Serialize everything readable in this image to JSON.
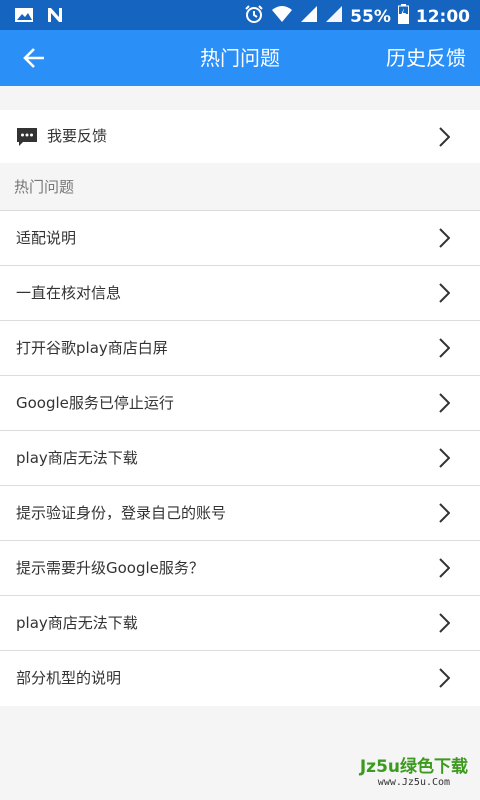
{
  "status_bar": {
    "battery": "55%",
    "time": "12:00",
    "icons": [
      "image-icon",
      "n-icon",
      "alarm-icon",
      "wifi-icon",
      "signal-icon",
      "signal-icon",
      "battery-charging-icon"
    ]
  },
  "app_bar": {
    "back_icon": "arrow-left-icon",
    "title": "热门问题",
    "history_label": "历史反馈"
  },
  "feedback": {
    "icon": "chat-bubble-icon",
    "label": "我要反馈",
    "chevron_icon": "chevron-right-icon"
  },
  "section": {
    "title": "热门问题"
  },
  "questions": [
    {
      "label": "适配说明"
    },
    {
      "label": "一直在核对信息"
    },
    {
      "label": "打开谷歌play商店白屏"
    },
    {
      "label": "Google服务已停止运行"
    },
    {
      "label": "play商店无法下载"
    },
    {
      "label": "提示验证身份，登录自己的账号"
    },
    {
      "label": "提示需要升级Google服务？"
    },
    {
      "label": "play商店无法下载"
    },
    {
      "label": "部分机型的说明"
    }
  ],
  "watermark": {
    "main": "Jz5u绿色下载",
    "sub": "www.Jz5u.Com"
  },
  "colors": {
    "status_bar": "#1565c0",
    "app_bar": "#2a8ff7",
    "background": "#f5f5f5",
    "divider": "#dcdcdc"
  }
}
